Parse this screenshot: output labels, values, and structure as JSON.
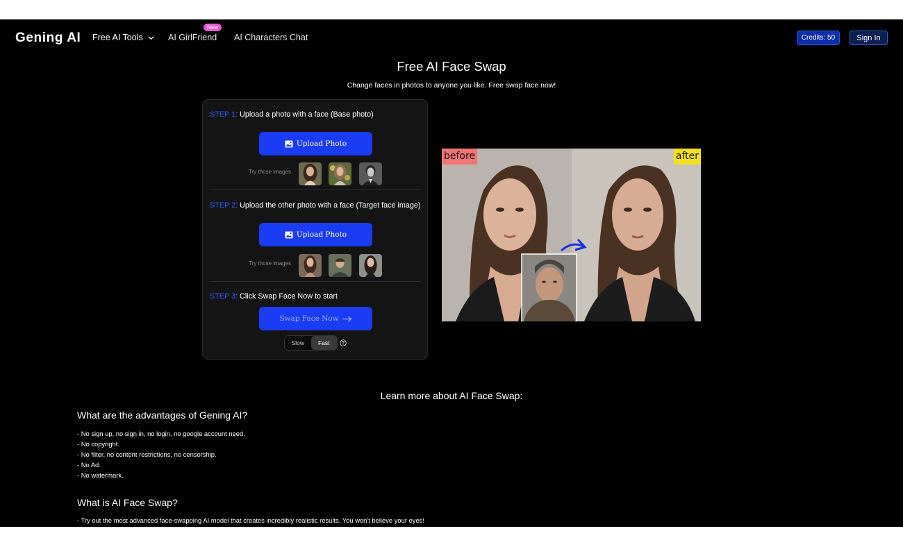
{
  "nav": {
    "brand": "Gening AI",
    "tools_label": "Free AI Tools",
    "girlfriend_label": "AI GirlFriend",
    "new_badge": "New",
    "chat_label": "AI Characters Chat",
    "credits_label": "Credits: 50",
    "signin_label": "Sign In"
  },
  "hero": {
    "title": "Free AI Face Swap",
    "subtitle": "Change faces in photos to anyone you like. Free swap face now!"
  },
  "panel": {
    "step1": {
      "num": "STEP 1:",
      "text": " Upload a photo with a face (Base photo)"
    },
    "step2": {
      "num": "STEP 2:",
      "text": " Upload the other photo with a face (Target face image)"
    },
    "step3": {
      "num": "STEP 3:",
      "text": " Click Swap Face Now to start"
    },
    "upload_label": "Upload Photo",
    "try_label": "Try those images",
    "swap_label": "Swap Face Now",
    "mode_slow": "Slow",
    "mode_fast": "Fast",
    "mode_selected": "Fast"
  },
  "demo": {
    "before_label": "before",
    "after_label": "after"
  },
  "learn": {
    "title": "Learn more about AI Face Swap:",
    "advantages_title": "What are the advantages of Gening AI?",
    "advantages": [
      "- No sign up, no sign in, no login, no google account need.",
      "- No copyright.",
      "- No filter, no content restrictions, no censorship.",
      "- No Ad.",
      "- No watermark."
    ],
    "what_title": "What is AI Face Swap?",
    "what_items": [
      "- Try out the most advanced face-swapping AI model that creates incredibly realistic results. You won't believe your eyes!"
    ]
  },
  "colors": {
    "accent": "#1a3cf5",
    "step_label": "#2e5dff",
    "before_tag": "#f17575",
    "after_tag": "#f4e01c"
  }
}
